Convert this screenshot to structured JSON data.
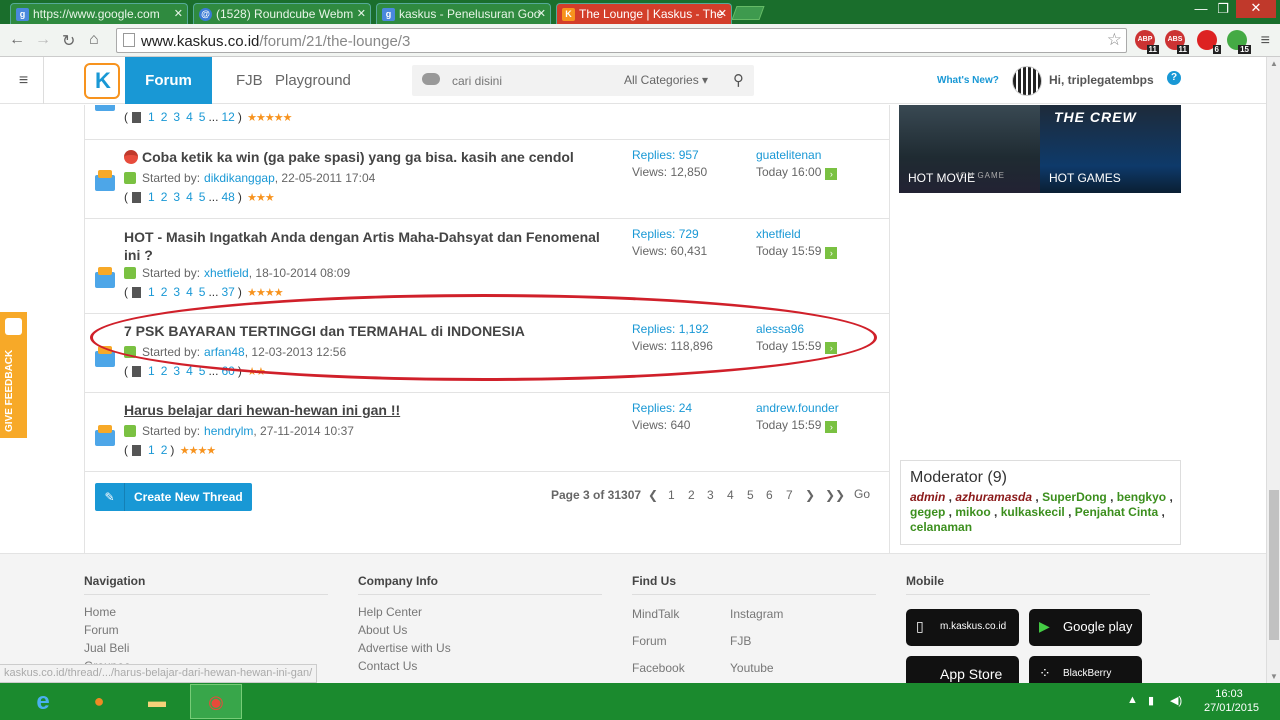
{
  "browser": {
    "tabs": [
      {
        "label": "https://www.google.com",
        "favicon": "google-icon"
      },
      {
        "label": "(1528) Roundcube Webm",
        "favicon": "roundcube-icon"
      },
      {
        "label": "kaskus - Penelusuran Goo",
        "favicon": "google-icon"
      },
      {
        "label": "The Lounge | Kaskus - The",
        "favicon": "kaskus-icon"
      }
    ],
    "url_host": "www.kaskus.co.id",
    "url_path": "/forum/21/the-lounge/3",
    "extensions": [
      {
        "name": "ABP",
        "badge": "11"
      },
      {
        "name": "ABS",
        "badge": "11"
      },
      {
        "name": "ext3",
        "badge": "6"
      },
      {
        "name": "ext4",
        "badge": "15"
      }
    ]
  },
  "header": {
    "nav": [
      "Forum",
      "FJB",
      "Playground"
    ],
    "search_placeholder": "cari disini",
    "category": "All Categories",
    "whats_new": "What's New?",
    "greeting": "Hi, triplegatembps"
  },
  "threads": [
    {
      "title": "",
      "started_label": "",
      "starter": "",
      "date": "",
      "pages": [
        "1",
        "2",
        "3",
        "4",
        "5",
        "...",
        "12"
      ],
      "rating": 5,
      "replies": "",
      "views": "",
      "last_user": "",
      "last_time": ""
    },
    {
      "title": "Coba ketik ka win (ga pake spasi) yang ga bisa. kasih ane cendol",
      "started_label": "Started by:",
      "starter": "dikdikanggap",
      "date": ", 22-05-2011 17:04",
      "pages": [
        "1",
        "2",
        "3",
        "4",
        "5",
        "...",
        "48"
      ],
      "rating": 3,
      "replies": "Replies: 957",
      "views": "Views: 12,850",
      "last_user": "guatelitenan",
      "last_time": "Today 16:00"
    },
    {
      "title": "HOT - Masih Ingatkah Anda dengan Artis Maha-Dahsyat dan Fenomenal ini ?",
      "started_label": "Started by:",
      "starter": "xhetfield",
      "date": ", 18-10-2014 08:09",
      "pages": [
        "1",
        "2",
        "3",
        "4",
        "5",
        "...",
        "37"
      ],
      "rating": 4,
      "replies": "Replies: 729",
      "views": "Views: 60,431",
      "last_user": "xhetfield",
      "last_time": "Today 15:59"
    },
    {
      "title": "7 PSK BAYARAN TERTINGGI dan TERMAHAL di INDONESIA",
      "started_label": "Started by:",
      "starter": "arfan48",
      "date": ", 12-03-2013 12:56",
      "pages": [
        "1",
        "2",
        "3",
        "4",
        "5",
        "...",
        "60"
      ],
      "rating": 2,
      "replies": "Replies: 1,192",
      "views": "Views: 118,896",
      "last_user": "alessa96",
      "last_time": "Today 15:59"
    },
    {
      "title": "Harus belajar dari hewan-hewan ini gan !!",
      "started_label": "Started by:",
      "starter": "hendrylm",
      "date": ", 27-11-2014 10:37",
      "pages": [
        "1",
        "2"
      ],
      "rating": 4,
      "replies": "Replies: 24",
      "views": "Views: 640",
      "last_user": "andrew.founder",
      "last_time": "Today 15:59"
    }
  ],
  "actions": {
    "new_thread": "Create New Thread"
  },
  "pagination": {
    "label": "Page 3 of 31307",
    "pages": [
      "1",
      "2",
      "3",
      "4",
      "5",
      "6",
      "7"
    ],
    "current": "3",
    "go": "Go"
  },
  "sidebar": {
    "hot_movie": "HOT MOVIE",
    "hot_games": "HOT GAMES",
    "hot_games_art": "THE CREW",
    "hot_movie_art": "ION GAME",
    "moderator_title": "Moderator (9)",
    "moderators_admin": [
      "admin",
      "azhuramasda"
    ],
    "moderators": [
      "SuperDong",
      "bengkyo",
      "gegep",
      "mikoo",
      "kulkaskecil",
      "Penjahat Cinta",
      "celanaman"
    ]
  },
  "feedback": "GIVE FEEDBACK",
  "footer": {
    "navigation": {
      "title": "Navigation",
      "links": [
        "Home",
        "Forum",
        "Jual Beli",
        "Groupee"
      ]
    },
    "company": {
      "title": "Company Info",
      "links": [
        "Help Center",
        "About Us",
        "Advertise with Us",
        "Contact Us"
      ]
    },
    "find_us": {
      "title": "Find Us",
      "links": [
        "MindTalk",
        "Instagram",
        "Forum",
        "FJB",
        "Facebook",
        "Youtube"
      ]
    },
    "mobile": {
      "title": "Mobile",
      "badges": [
        "m.kaskus.co.id",
        "Google play",
        "App Store",
        "BlackBerry"
      ]
    }
  },
  "status_url": "kaskus.co.id/thread/.../harus-belajar-dari-hewan-hewan-ini-gan/",
  "taskbar": {
    "time": "16:03",
    "date": "27/01/2015"
  },
  "colors": {
    "accent": "#1998d5",
    "annotation": "#d0202a",
    "taskbar": "#1b8a2e",
    "star": "#f7931e"
  }
}
